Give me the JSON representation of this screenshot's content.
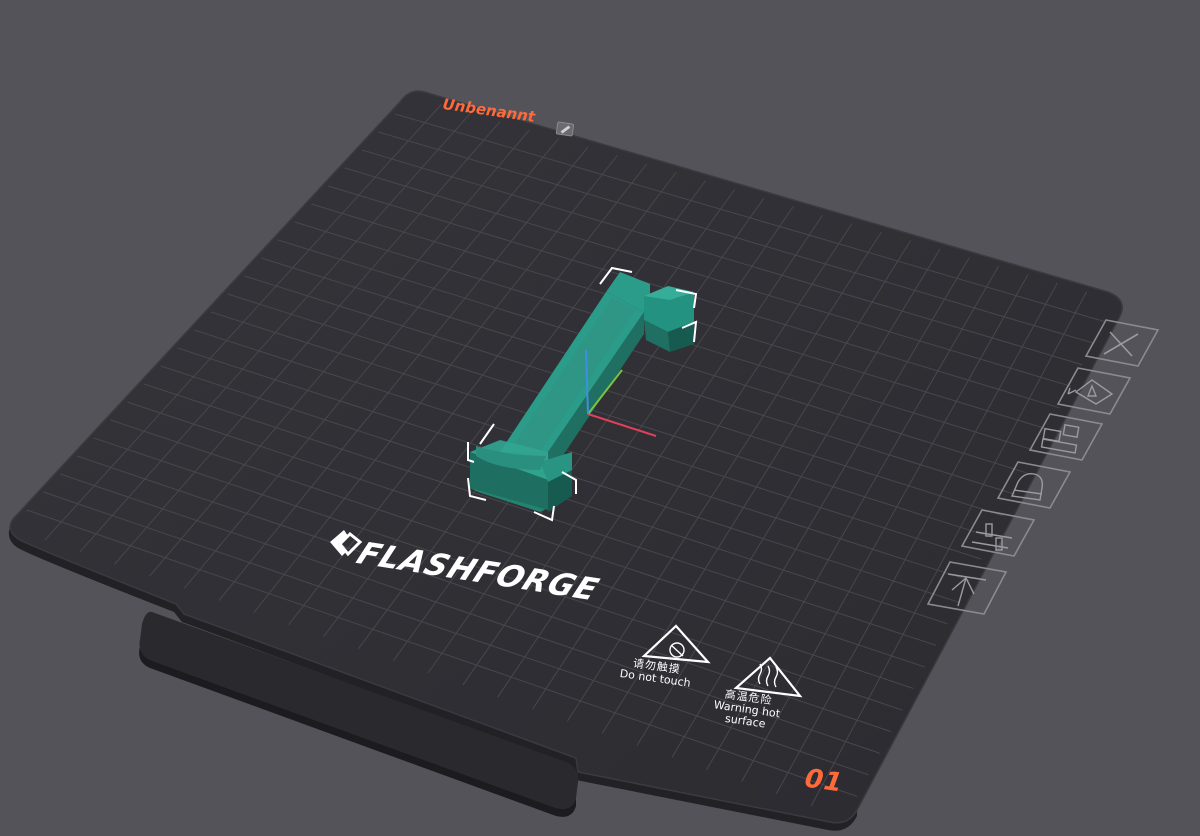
{
  "plate": {
    "name": "Unbenannt",
    "index": "01",
    "brand": "FLASHFORGE",
    "warnings": [
      {
        "zh": "请勿触摸",
        "en": "Do not touch"
      },
      {
        "zh": "高温危险",
        "en": "Warning hot",
        "en2": "surface"
      }
    ]
  },
  "toolbar": [
    {
      "id": "delete",
      "icon": "close-icon"
    },
    {
      "id": "auto-orient",
      "icon": "orient-icon"
    },
    {
      "id": "arrange",
      "icon": "arrange-icon"
    },
    {
      "id": "lock",
      "icon": "lock-icon"
    },
    {
      "id": "plate-settings",
      "icon": "settings-icon"
    },
    {
      "id": "move-to-top",
      "icon": "move-up-icon"
    }
  ],
  "colors": {
    "background": "#535359",
    "plate": "#2e2e33",
    "grid": "#4a4a50",
    "model": "#2a8f7f",
    "accent": "#ff6a3a",
    "axis_x": "#e0405a",
    "axis_y": "#7bc143",
    "axis_z": "#3f8fe0"
  }
}
